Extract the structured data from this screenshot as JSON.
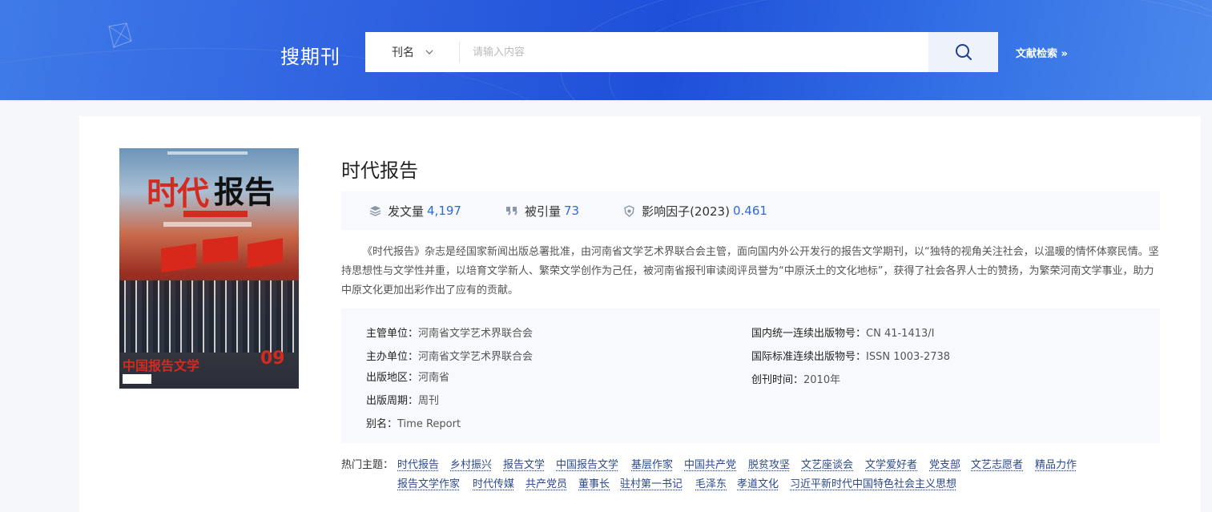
{
  "header": {
    "title": "搜期刊",
    "search_type": "刊名",
    "search_placeholder": "请输入内容",
    "advanced_link": "文献检索 »"
  },
  "journal": {
    "name": "时代报告",
    "cover": {
      "title_red": "时代",
      "title_black": "报告",
      "bottom_text": "中国报告文学",
      "issue": "09"
    },
    "stats": [
      {
        "label": "发文量",
        "value": "4,197",
        "icon": "layers-icon"
      },
      {
        "label": "被引量",
        "value": "73",
        "icon": "quote-icon"
      },
      {
        "label": "影响因子(2023)",
        "value": "0.461",
        "icon": "shield-icon"
      }
    ],
    "description": "《时代报告》杂志是经国家新闻出版总署批准，由河南省文学艺术界联合会主管，面向国内外公开发行的报告文学期刊，以“独特的视角关注社会，以温暖的情怀体察民情。坚持思想性与文学性并重，以培育文学新人、繁荣文学创作为己任，被河南省报刊审读阅评员誉为“中原沃土的文化地标”，获得了社会各界人士的赞扬，为繁荣河南文学事业，助力中原文化更加出彩作出了应有的贡献。",
    "info_left": [
      {
        "label": "主管单位：",
        "value": "河南省文学艺术界联合会"
      },
      {
        "label": "主办单位：",
        "value": "河南省文学艺术界联合会"
      },
      {
        "label": "出版地区：",
        "value": "河南省"
      },
      {
        "label": "出版周期：",
        "value": "周刊"
      },
      {
        "label": "别名：",
        "value": "Time Report"
      }
    ],
    "info_right": [
      {
        "label": "国内统一连续出版物号：",
        "value": "CN 41-1413/I"
      },
      {
        "label": "国际标准连续出版物号：",
        "value": "ISSN 1003-2738"
      },
      {
        "label": "创刊时间：",
        "value": "2010年"
      }
    ],
    "topics_label": "热门主题：",
    "topics_row1": [
      "时代报告",
      "乡村振兴",
      "报告文学",
      "中国报告文学",
      "基层作家",
      "中国共产党",
      "脱贫攻坚",
      "文艺座谈会",
      "文学爱好者",
      "党支部",
      "文艺志愿者",
      "精品力作"
    ],
    "topics_row2": [
      "报告文学作家",
      "时代传媒",
      "共产党员",
      "董事长",
      "驻村第一书记",
      "毛泽东",
      "孝道文化",
      "习近平新时代中国特色社会主义思想"
    ]
  }
}
